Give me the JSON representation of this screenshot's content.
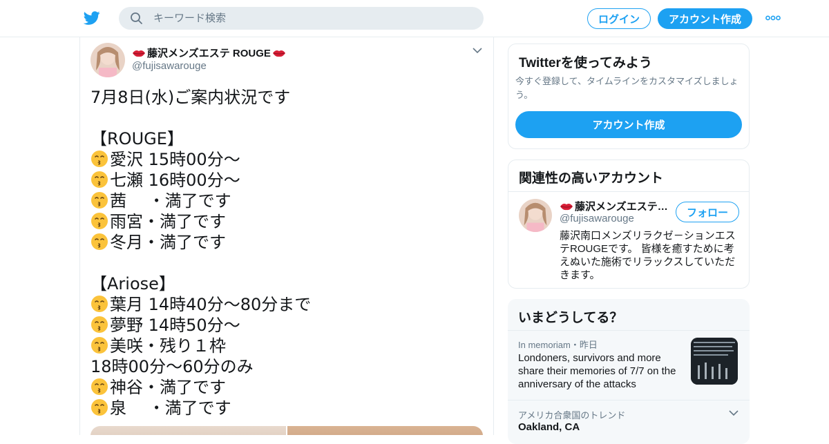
{
  "colors": {
    "brand": "#1da1f2",
    "text": "#14171a",
    "muted": "#657786",
    "border": "#e6ecf0",
    "panel_bg": "#f5f8fa"
  },
  "header": {
    "logo_icon": "twitter-bird-icon",
    "search": {
      "icon": "search-icon",
      "placeholder": "キーワード検索"
    },
    "login_label": "ログイン",
    "signup_label": "アカウント作成",
    "more_icon": "more-dots-icon"
  },
  "tweet": {
    "author_name": "藤沢メンズエステ ROUGE",
    "name_decoration_icon": "lips-emoji-icon",
    "author_handle": "@fujisawarouge",
    "menu_icon": "chevron-down-icon",
    "emoji_icon": "kissing-face-emoji-icon",
    "lines": [
      {
        "emoji": false,
        "text": "7月8日(水)ご案内状況です"
      },
      {
        "emoji": false,
        "text": ""
      },
      {
        "emoji": false,
        "text": "【ROUGE】"
      },
      {
        "emoji": true,
        "text": "愛沢 15時00分～"
      },
      {
        "emoji": true,
        "text": "七瀬 16時00分～"
      },
      {
        "emoji": true,
        "text": "茜　 ・満了です"
      },
      {
        "emoji": true,
        "text": "雨宮・満了です"
      },
      {
        "emoji": true,
        "text": "冬月・満了です"
      },
      {
        "emoji": false,
        "text": ""
      },
      {
        "emoji": false,
        "text": "【Ariose】"
      },
      {
        "emoji": true,
        "text": "葉月 14時40分～80分まで"
      },
      {
        "emoji": true,
        "text": "夢野 14時50分～"
      },
      {
        "emoji": true,
        "text": "美咲・残り１枠"
      },
      {
        "emoji": false,
        "text": "18時00分～60分のみ"
      },
      {
        "emoji": true,
        "text": "神谷・満了です"
      },
      {
        "emoji": true,
        "text": "泉　 ・満了です"
      }
    ]
  },
  "sidebar": {
    "signup_card": {
      "title": "Twitterを使ってみよう",
      "description": "今すぐ登録して、タイムラインをカスタマイズしましょう。",
      "button_label": "アカウント作成"
    },
    "related_card": {
      "title": "関連性の高いアカウント",
      "account_name": "藤沢メンズエステ…",
      "account_handle": "@fujisawarouge",
      "follow_label": "フォロー",
      "bio": "藤沢南口メンズリラクゼ－ションエステROUGEです。 皆様を癒すために考えぬいた施術でリラックスしていただきます。"
    },
    "trends_card": {
      "title": "いまどうしてる？",
      "trend1_meta": "In memoriam・昨日",
      "trend1_text": "Londoners, survivors and more share their memories of 7/7 on the anniversary of the attacks",
      "trend2_meta": "アメリカ合衆国のトレンド",
      "trend2_text": "Oakland, CA"
    }
  }
}
